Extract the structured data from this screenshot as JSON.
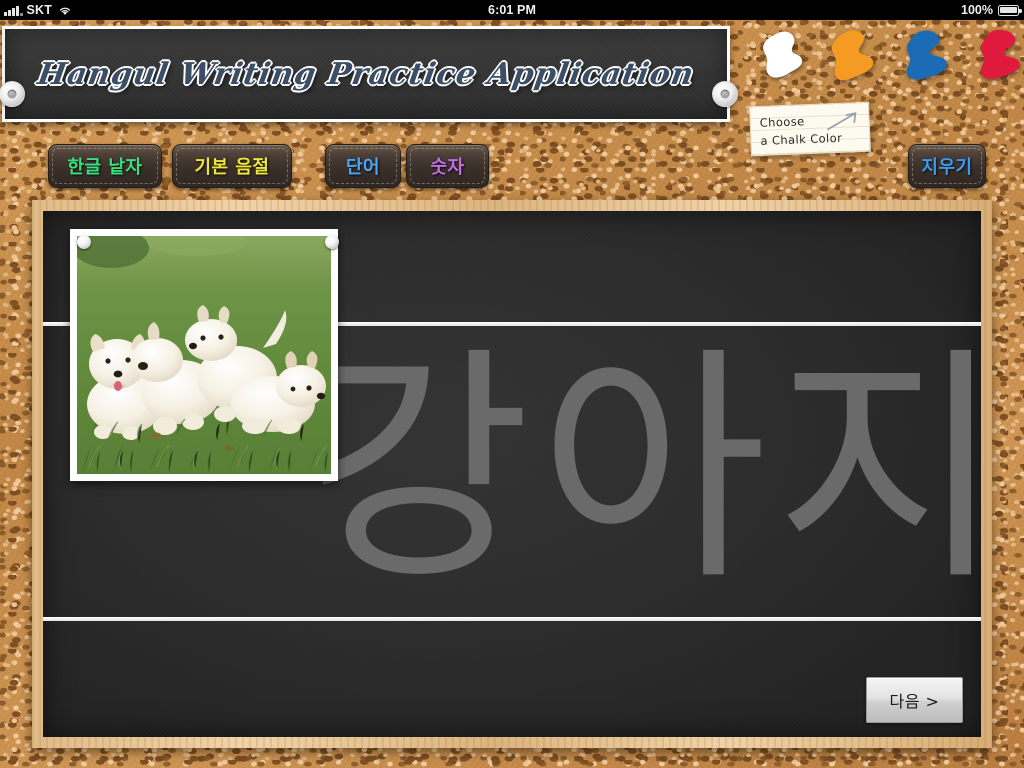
{
  "status_bar": {
    "carrier": "SKT",
    "time": "6:01 PM",
    "battery": "100%",
    "signal_icon": "signal-bars-icon",
    "wifi_icon": "wifi-icon",
    "battery_icon": "battery-full-icon"
  },
  "header": {
    "title": "Hangul Writing Practice Application"
  },
  "chalk": {
    "note_line1": "Choose",
    "note_line2": "a Chalk Color",
    "colors": [
      {
        "name": "white",
        "hex": "#FFFFFF"
      },
      {
        "name": "orange",
        "hex": "#F59A22"
      },
      {
        "name": "blue",
        "hex": "#1C6CB5"
      },
      {
        "name": "red",
        "hex": "#E01A3C"
      }
    ]
  },
  "menu": {
    "buttons": [
      {
        "label": "한글 낱자",
        "color": "#3BE07E"
      },
      {
        "label": "기본 음절",
        "color": "#EDE53A"
      },
      {
        "label": "단어",
        "color": "#48A8FF"
      },
      {
        "label": "숫자",
        "color": "#C86BE8"
      }
    ],
    "erase": {
      "label": "지우기",
      "color": "#3B9BF0"
    }
  },
  "board": {
    "trace_word": "강아지",
    "trace_color": "#6A6A6A",
    "photo_caption": "puppies-photo",
    "next_label": "다음 >"
  }
}
